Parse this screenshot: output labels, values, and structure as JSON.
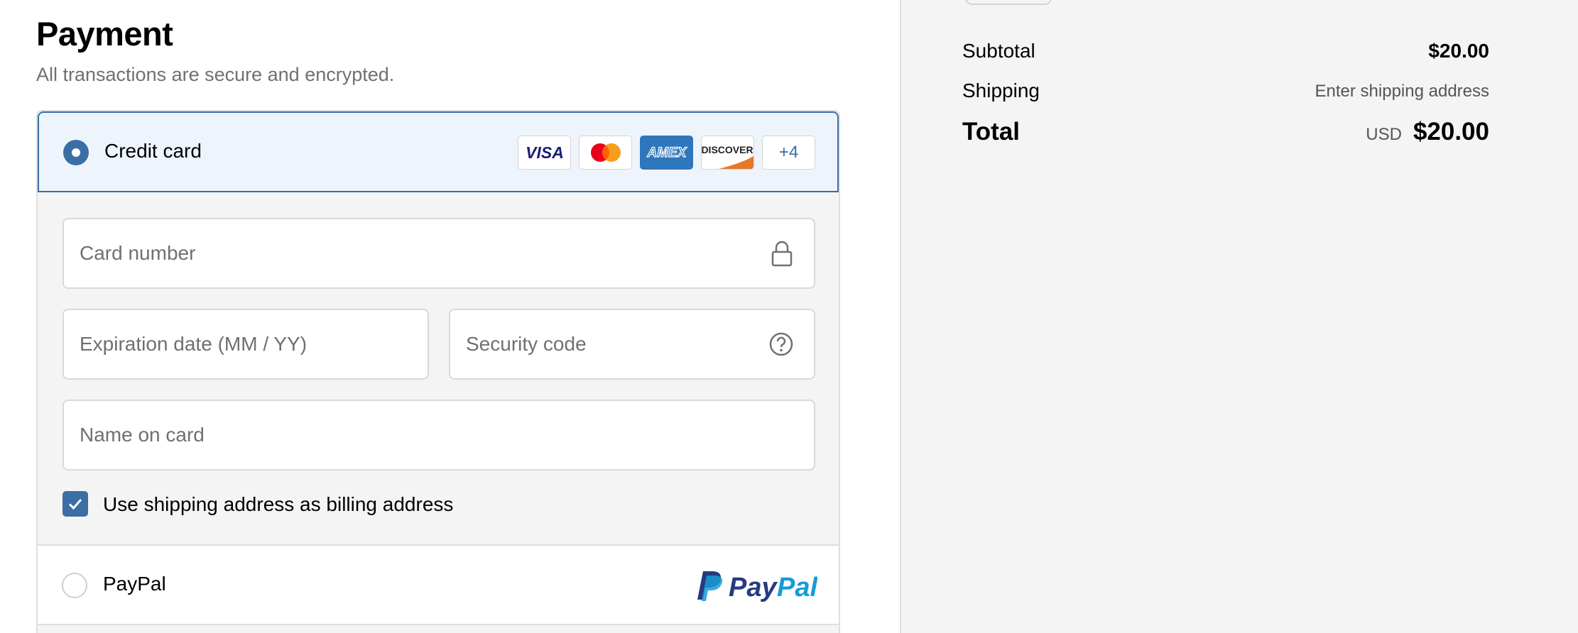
{
  "payment": {
    "title": "Payment",
    "subtitle": "All transactions are secure and encrypted.",
    "credit_card": {
      "label": "Credit card",
      "selected": true,
      "card_brands": [
        "VISA",
        "mastercard",
        "AMEX",
        "DISCOVER"
      ],
      "more_brands": "+4"
    },
    "fields": {
      "card_number_placeholder": "Card number",
      "expiration_placeholder": "Expiration date (MM / YY)",
      "security_code_placeholder": "Security code",
      "name_placeholder": "Name on card"
    },
    "billing": {
      "label": "Use shipping address as billing address",
      "checked": true
    },
    "paypal": {
      "label": "PayPal",
      "logo_text": "PayPal",
      "selected": false
    }
  },
  "summary": {
    "subtotal_label": "Subtotal",
    "subtotal_value": "$20.00",
    "shipping_label": "Shipping",
    "shipping_value": "Enter shipping address",
    "total_label": "Total",
    "total_currency": "USD",
    "total_value": "$20.00"
  },
  "colors": {
    "accent": "#3a6ea5",
    "selected_bg": "#eef4fc",
    "panel_bg": "#f4f4f4",
    "muted_text": "#707070"
  },
  "icons": [
    "lock-icon",
    "help-circle-icon",
    "check-icon",
    "paypal-logo",
    "visa-logo",
    "mastercard-logo",
    "amex-logo",
    "discover-logo"
  ]
}
